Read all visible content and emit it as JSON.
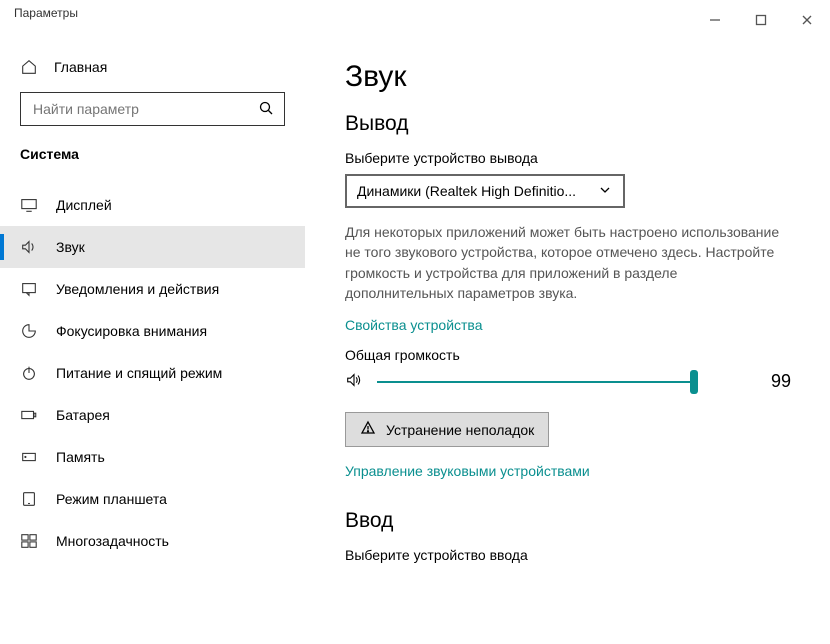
{
  "titlebar": {
    "title": "Параметры"
  },
  "sidebar": {
    "home": "Главная",
    "search_placeholder": "Найти параметр",
    "section": "Система",
    "items": [
      {
        "label": "Дисплей"
      },
      {
        "label": "Звук"
      },
      {
        "label": "Уведомления и действия"
      },
      {
        "label": "Фокусировка внимания"
      },
      {
        "label": "Питание и спящий режим"
      },
      {
        "label": "Батарея"
      },
      {
        "label": "Память"
      },
      {
        "label": "Режим планшета"
      },
      {
        "label": "Многозадачность"
      }
    ]
  },
  "main": {
    "title": "Звук",
    "output_heading": "Вывод",
    "output_label": "Выберите устройство вывода",
    "output_device": "Динамики (Realtek High Definitio...",
    "output_desc": "Для некоторых приложений может быть настроено использование не того звукового устройства, которое отмечено здесь. Настройте громкость и устройства для приложений в разделе дополнительных параметров звука.",
    "device_props_link": "Свойства устройства",
    "master_volume_label": "Общая громкость",
    "volume_value": "99",
    "troubleshoot_btn": "Устранение неполадок",
    "manage_devices_link": "Управление звуковыми устройствами",
    "input_heading": "Ввод",
    "input_label": "Выберите устройство ввода"
  }
}
